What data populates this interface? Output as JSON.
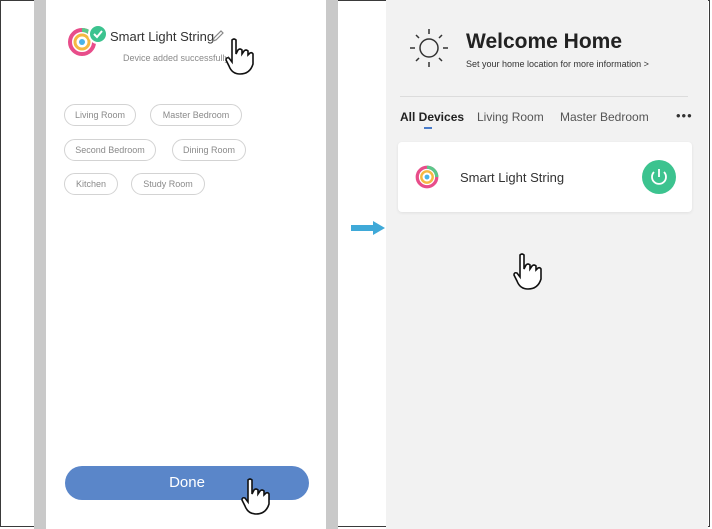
{
  "colors": {
    "accent_blue": "#5a86c9",
    "success_green": "#3cc38f",
    "arrow_blue": "#3fa9d8",
    "panel_gray": "#f2f2f2"
  },
  "left": {
    "device_name": "Smart Light String",
    "device_status": "Device added successfully",
    "rooms": [
      "Living Room",
      "Master Bedroom",
      "Second Bedroom",
      "Dining Room",
      "Kitchen",
      "Study Room"
    ],
    "done_label": "Done"
  },
  "right": {
    "title": "Welcome Home",
    "subtitle": "Set your home location for more information >",
    "tabs": [
      "All Devices",
      "Living Room",
      "Master Bedroom"
    ],
    "more": "•••",
    "device_card": {
      "name": "Smart Light String",
      "power_icon": "power-icon"
    }
  }
}
